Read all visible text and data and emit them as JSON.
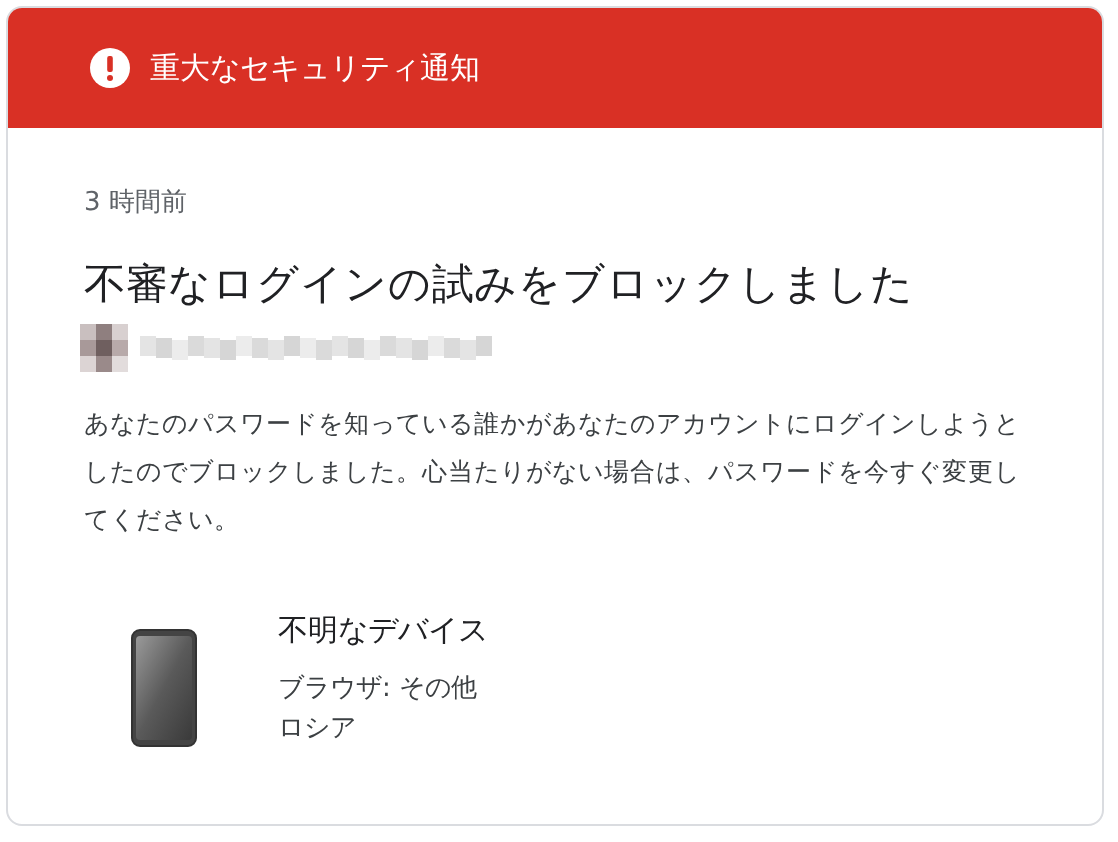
{
  "header": {
    "title": "重大なセキュリティ通知"
  },
  "time": "3 時間前",
  "heading": "不審なログインの試みをブロックしました",
  "message": "あなたのパスワードを知っている誰かがあなたのアカウントにログインしようとしたのでブロックしました。心当たりがない場合は、パスワードを今すぐ変更してください。",
  "device": {
    "name": "不明なデバイス",
    "browser": "ブラウザ: その他",
    "location": "ロシア"
  }
}
